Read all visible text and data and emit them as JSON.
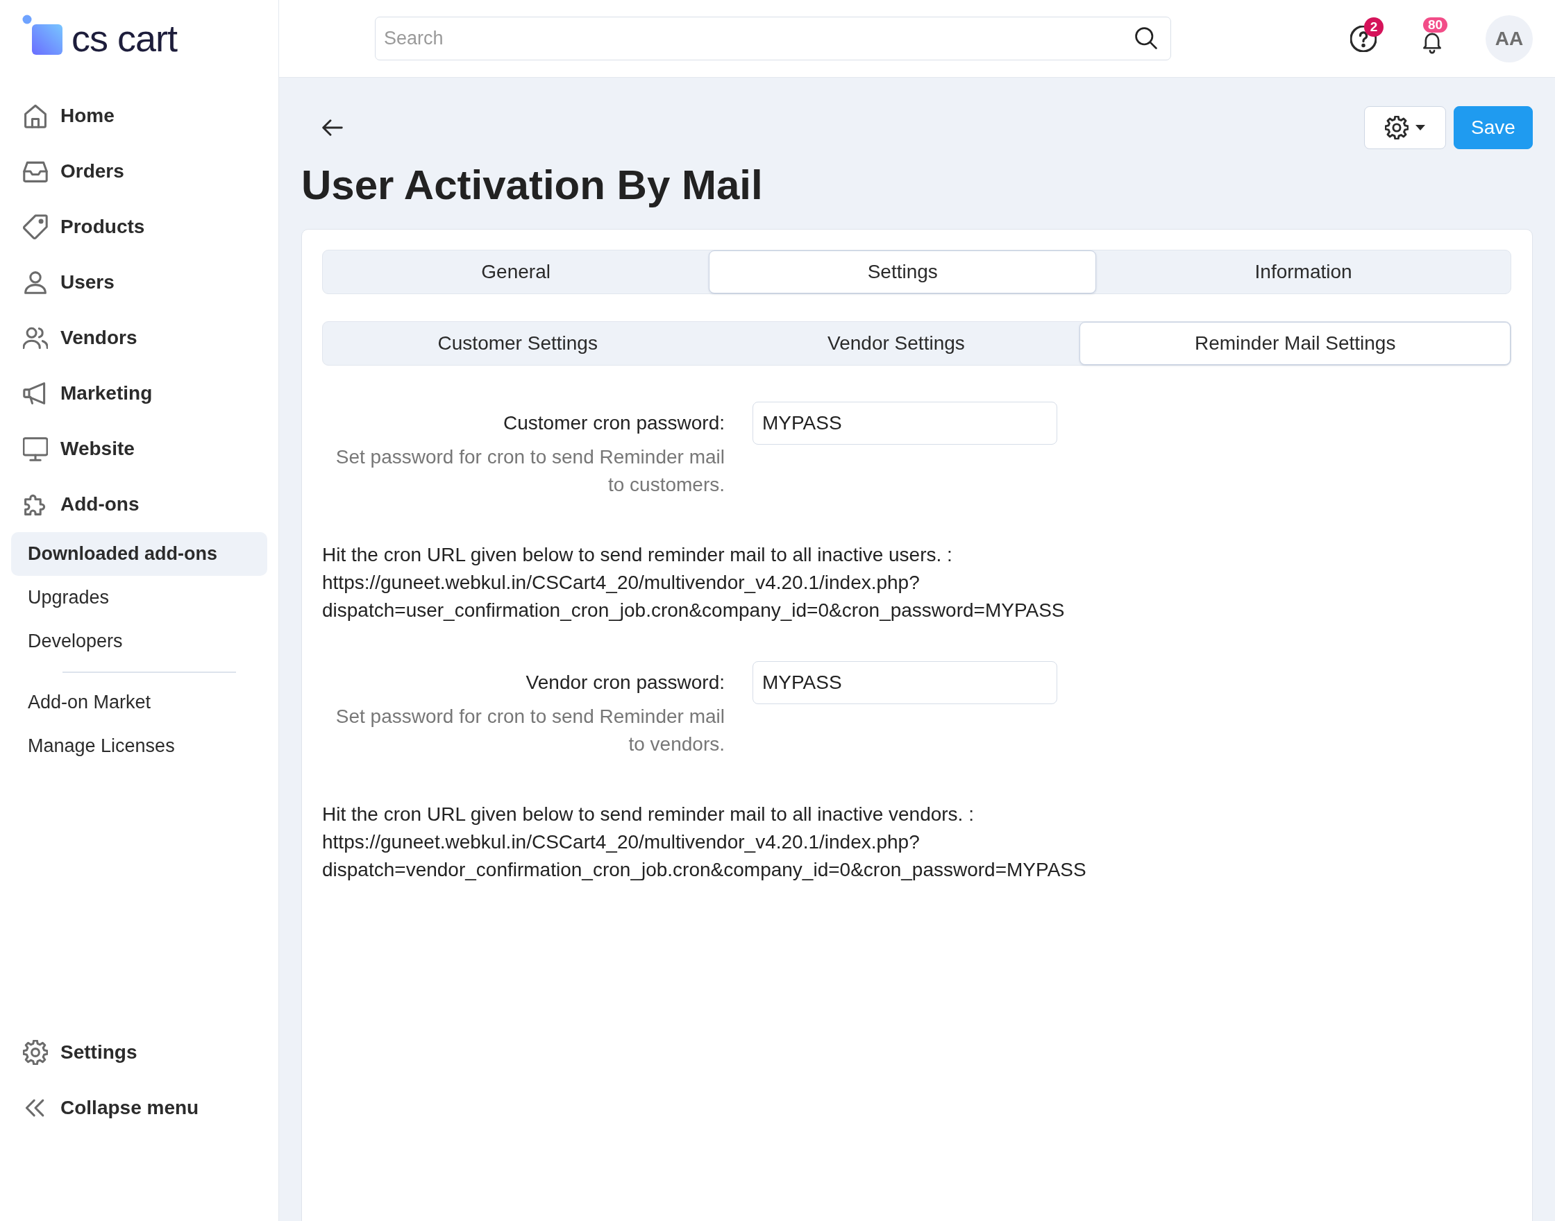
{
  "logo": {
    "text": "cs cart"
  },
  "sidebar": {
    "items": [
      {
        "label": "Home",
        "selected": false
      },
      {
        "label": "Orders",
        "selected": false
      },
      {
        "label": "Products",
        "selected": false
      },
      {
        "label": "Users",
        "selected": false
      },
      {
        "label": "Vendors",
        "selected": false
      },
      {
        "label": "Marketing",
        "selected": false
      },
      {
        "label": "Website",
        "selected": false
      },
      {
        "label": "Add-ons",
        "selected": false,
        "children": [
          {
            "label": "Downloaded add-ons",
            "selected": true,
            "separated": false
          },
          {
            "label": "Upgrades",
            "selected": false,
            "separated": false
          },
          {
            "label": "Developers",
            "selected": false,
            "separated": false
          },
          {
            "label": "Add-on Market",
            "selected": false,
            "separated": true
          },
          {
            "label": "Manage Licenses",
            "selected": false,
            "separated": false
          }
        ]
      }
    ],
    "footer_items": [
      {
        "label": "Settings"
      },
      {
        "label": "Collapse menu"
      }
    ]
  },
  "topbar": {
    "search": {
      "placeholder": "Search"
    },
    "help": {
      "badge": "2"
    },
    "notifications": {
      "badge": "80"
    },
    "avatar": {
      "initials": "AA"
    }
  },
  "page": {
    "title": "User Activation By Mail",
    "save_button": "Save",
    "tabs": [
      {
        "label": "General",
        "selected": false
      },
      {
        "label": "Settings",
        "selected": true
      },
      {
        "label": "Information",
        "selected": false
      }
    ],
    "subtabs": [
      {
        "label": "Customer Settings",
        "selected": false
      },
      {
        "label": "Vendor Settings",
        "selected": false
      },
      {
        "label": "Reminder Mail Settings",
        "selected": true
      }
    ],
    "fields": [
      {
        "label": "Customer cron password:",
        "value": "MYPASS",
        "help": "Set password for cron to send Reminder mail to customers.",
        "note_lines": [
          "Hit the cron URL given below to send reminder mail to all inactive users. :",
          "https://guneet.webkul.in/CSCart4_20/multivendor_v4.20.1/index.php?",
          "dispatch=user_confirmation_cron_job.cron&company_id=0&cron_password=MYPASS"
        ]
      },
      {
        "label": "Vendor cron password:",
        "value": "MYPASS",
        "help": "Set password for cron to send Reminder mail to vendors.",
        "note_lines": [
          "Hit the cron URL given below to send reminder mail to all inactive vendors. :",
          "https://guneet.webkul.in/CSCart4_20/multivendor_v4.20.1/index.php?",
          "dispatch=vendor_confirmation_cron_job.cron&company_id=0&cron_password=MYPASS"
        ]
      }
    ]
  }
}
